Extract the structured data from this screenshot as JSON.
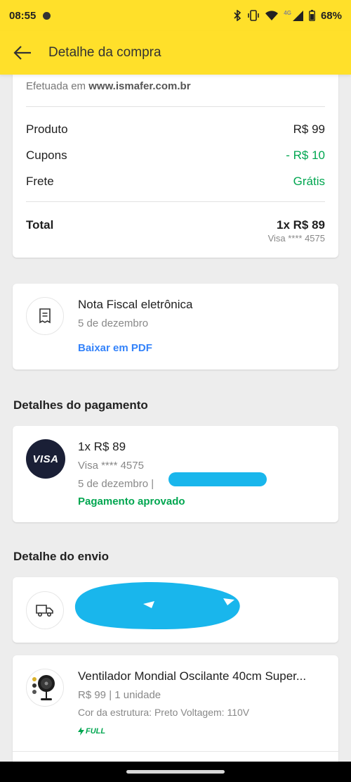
{
  "status_bar": {
    "time": "08:55",
    "battery": "68%",
    "network": "4G"
  },
  "app_bar": {
    "title": "Detalhe da compra"
  },
  "summary": {
    "sold_by_prefix": "Efetuada em",
    "sold_by_site": "www.ismafer.com.br",
    "product_label": "Produto",
    "product_value": "R$ 99",
    "coupons_label": "Cupons",
    "coupons_value": "- R$ 10",
    "shipping_label": "Frete",
    "shipping_value": "Grátis",
    "total_label": "Total",
    "total_value": "1x R$ 89",
    "total_sub": "Visa **** 4575"
  },
  "invoice": {
    "title": "Nota Fiscal eletrônica",
    "date": "5 de dezembro",
    "link": "Baixar em PDF"
  },
  "payment": {
    "section_title": "Detalhes do pagamento",
    "card_brand": "VISA",
    "amount": "1x R$ 89",
    "card": "Visa **** 4575",
    "date": "5 de dezembro  |",
    "status": "Pagamento aprovado"
  },
  "shipping": {
    "section_title": "Detalhe do envio"
  },
  "product": {
    "title": "Ventilador Mondial Oscilante 40cm Super...",
    "meta": "R$ 99 | 1 unidade",
    "attributes": "Cor da estrutura: Preto Voltagem: 110V",
    "badge": "FULL"
  },
  "colors": {
    "brand_yellow": "#ffe02a",
    "green": "#00a650",
    "link_blue": "#3483fa",
    "redaction": "#19b6ec"
  }
}
